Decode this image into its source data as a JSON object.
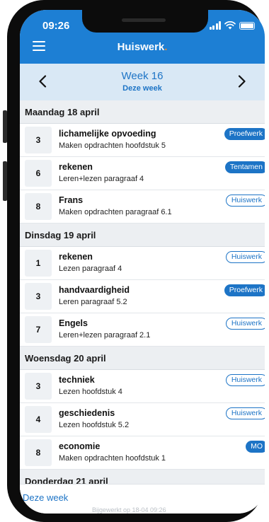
{
  "status_bar": {
    "time": "09:26"
  },
  "header": {
    "title": "Huiswerk"
  },
  "week_nav": {
    "title": "Week 16",
    "subtitle": "Deze week"
  },
  "days": [
    {
      "label": "Maandag 18 april",
      "items": [
        {
          "hour": "3",
          "subject": "lichamelijke opvoeding",
          "description": "Maken opdrachten hoofdstuk 5",
          "badge": "Proefwerk",
          "badge_style": "solid"
        },
        {
          "hour": "6",
          "subject": "rekenen",
          "description": "Leren+lezen paragraaf 4",
          "badge": "Tentamen",
          "badge_style": "solid"
        },
        {
          "hour": "8",
          "subject": "Frans",
          "description": "Maken opdrachten paragraaf 6.1",
          "badge": "Huiswerk",
          "badge_style": "outline"
        }
      ]
    },
    {
      "label": "Dinsdag 19 april",
      "items": [
        {
          "hour": "1",
          "subject": "rekenen",
          "description": "Lezen paragraaf 4",
          "badge": "Huiswerk",
          "badge_style": "outline"
        },
        {
          "hour": "3",
          "subject": "handvaardigheid",
          "description": "Leren paragraaf 5.2",
          "badge": "Proefwerk",
          "badge_style": "solid"
        },
        {
          "hour": "7",
          "subject": "Engels",
          "description": "Leren+lezen paragraaf 2.1",
          "badge": "Huiswerk",
          "badge_style": "outline"
        }
      ]
    },
    {
      "label": "Woensdag 20 april",
      "items": [
        {
          "hour": "3",
          "subject": "techniek",
          "description": "Lezen hoofdstuk 4",
          "badge": "Huiswerk",
          "badge_style": "outline"
        },
        {
          "hour": "4",
          "subject": "geschiedenis",
          "description": "Lezen hoofdstuk 5.2",
          "badge": "Huiswerk",
          "badge_style": "outline"
        },
        {
          "hour": "8",
          "subject": "economie",
          "description": "Maken opdrachten hoofdstuk 1",
          "badge": "MO",
          "badge_style": "solid"
        }
      ]
    },
    {
      "label": "Donderdag 21 april",
      "items": []
    }
  ],
  "bottom_bar": {
    "today_link": "Deze week",
    "footer_note": "Bijgewerkt op 18-04 09:26"
  },
  "colors": {
    "primary": "#1d7fd4",
    "accent_dot": "#f08a2a",
    "week_bar": "#d9e8f5",
    "day_header": "#eceff2"
  },
  "icons": [
    "menu-icon",
    "chevron-left-icon",
    "chevron-right-icon",
    "signal-icon",
    "wifi-icon",
    "battery-icon"
  ]
}
